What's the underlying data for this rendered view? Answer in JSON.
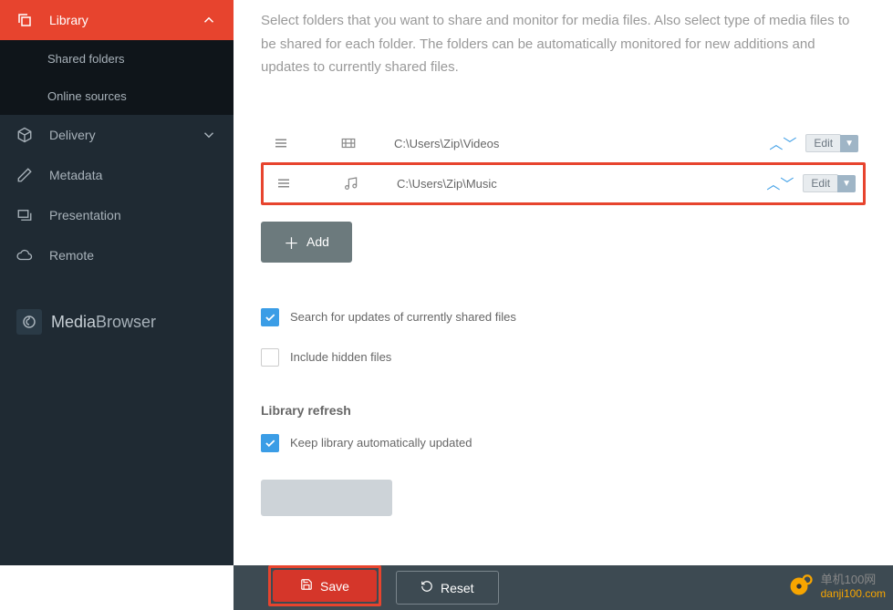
{
  "sidebar": {
    "library": {
      "label": "Library"
    },
    "sub_items": {
      "shared": "Shared folders",
      "online": "Online sources"
    },
    "delivery": {
      "label": "Delivery"
    },
    "metadata": {
      "label": "Metadata"
    },
    "presentation": {
      "label": "Presentation"
    },
    "remote": {
      "label": "Remote"
    },
    "brand": {
      "name1": "Media",
      "name2": "Browser"
    }
  },
  "intro": {
    "text": "Select folders that you want to share and monitor for media files. Also select type of media files to be shared for each folder. The folders can be automatically monitored for new additions and updates to currently shared files."
  },
  "folders": [
    {
      "path": "C:\\Users\\Zip\\Videos",
      "type": "video",
      "highlighted": false
    },
    {
      "path": "C:\\Users\\Zip\\Music",
      "type": "music",
      "highlighted": true
    }
  ],
  "buttons": {
    "add": "Add",
    "edit": "Edit",
    "save": "Save",
    "reset": "Reset"
  },
  "options": {
    "search_updates": {
      "label": "Search for updates of currently shared files",
      "checked": true
    },
    "hidden_files": {
      "label": "Include hidden files",
      "checked": false
    },
    "auto_update": {
      "label": "Keep library automatically updated",
      "checked": true
    }
  },
  "sections": {
    "refresh": "Library refresh"
  },
  "watermark": {
    "label": "单机100网",
    "url": "danji100.com"
  }
}
